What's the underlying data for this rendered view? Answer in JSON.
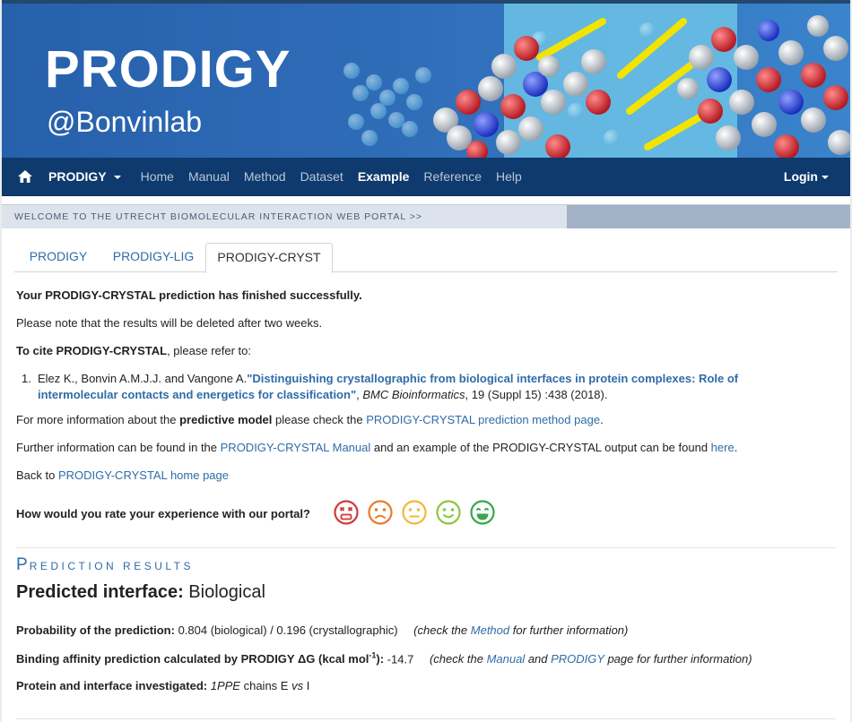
{
  "banner": {
    "title": "PRODIGY",
    "subtitle": "@Bonvinlab"
  },
  "navbar": {
    "brand": "PRODIGY",
    "items": [
      "Home",
      "Manual",
      "Method",
      "Dataset",
      "Example",
      "Reference",
      "Help"
    ],
    "active": "Example",
    "login": "Login"
  },
  "welcome": "WELCOME TO THE UTRECHT BIOMOLECULAR INTERACTION WEB PORTAL >>",
  "tabs": [
    "PRODIGY",
    "PRODIGY-LIG",
    "PRODIGY-CRYST"
  ],
  "active_tab": "PRODIGY-CRYST",
  "messages": {
    "success": "Your PRODIGY-CRYSTAL prediction has finished successfully.",
    "deletion_note": "Please note that the results will be deleted after two weeks.",
    "cite_bold": "To cite PRODIGY-CRYSTAL",
    "cite_rest": ", please refer to:",
    "ref_number": "1.",
    "ref_authors": "Elez K., Bonvin A.M.J.J. and Vangone A.",
    "ref_title": "\"Distinguishing crystallographic from biological interfaces in protein complexes: Role of intermolecular contacts and energetics for classification\"",
    "ref_journal": "BMC Bioinformatics",
    "ref_details": ", 19 (Suppl 15) :438 (2018).",
    "info_prefix": "For more information about the ",
    "info_bold": "predictive model",
    "info_mid": " please check the ",
    "info_link": "PRODIGY-CRYSTAL prediction method page",
    "info_end": ".",
    "further_prefix": "Further information can be found in the ",
    "further_link1": "PRODIGY-CRYSTAL Manual",
    "further_mid": " and an example of the PRODIGY-CRYSTAL output can be found ",
    "further_link2": "here",
    "further_end": ".",
    "back_prefix": "Back to ",
    "back_link": "PRODIGY-CRYSTAL home page",
    "rating_question": "How would you rate your experience with our portal?"
  },
  "rating_faces": [
    {
      "icon": "face-very-bad-icon",
      "color": "#d0393b"
    },
    {
      "icon": "face-bad-icon",
      "color": "#ec7a2c"
    },
    {
      "icon": "face-neutral-icon",
      "color": "#f0b93a"
    },
    {
      "icon": "face-good-icon",
      "color": "#8cc63f"
    },
    {
      "icon": "face-very-good-icon",
      "color": "#3aa64a"
    }
  ],
  "results": {
    "section_title_cap": "P",
    "section_title_rest": "REDICTION RESULTS",
    "predicted_label": "Predicted interface:",
    "predicted_value": "Biological",
    "prob_label": "Probability of the prediction:",
    "prob_value": "0.804 (biological) / 0.196 (crystallographic)",
    "prob_note_prefix": "(check the ",
    "prob_note_link": "Method",
    "prob_note_suffix": " for further information)",
    "affinity_label": "Binding affinity prediction calculated by PRODIGY ΔG (kcal mol",
    "affinity_sup": "-1",
    "affinity_label_end": "):",
    "affinity_value": "-14.7",
    "affinity_note_prefix": "(check the ",
    "affinity_note_link1": "Manual",
    "affinity_note_mid": " and ",
    "affinity_note_link2": "PRODIGY",
    "affinity_note_suffix": " page for further information)",
    "protein_label": "Protein and interface investigated:",
    "protein_pdb": "1PPE",
    "protein_chains": " chains E ",
    "protein_vs": "vs",
    "protein_end": " I"
  },
  "colors": {
    "link": "#2f6ca8",
    "navbar": "#0f3a6e",
    "banner": "#2a67b1"
  }
}
